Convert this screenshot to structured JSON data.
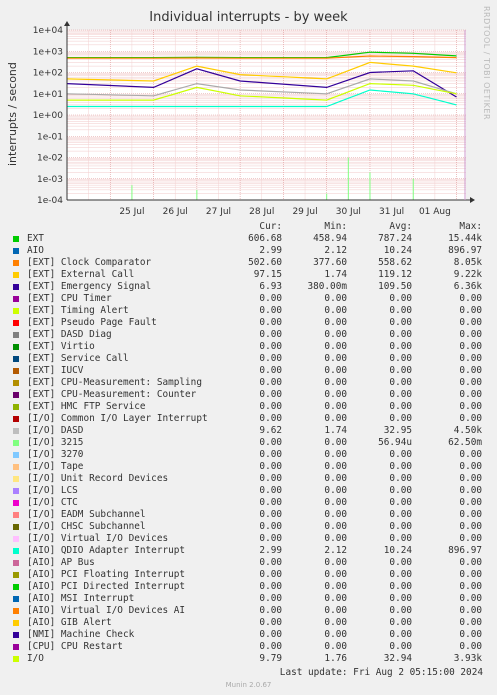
{
  "chart_data": {
    "type": "line",
    "title": "Individual interrupts - by week",
    "ylabel": "interrupts / second",
    "yscale": "log",
    "ylim": [
      0.0001,
      10000
    ],
    "yticks": [
      "1e-04",
      "1e-03",
      "1e-02",
      "1e-01",
      "1e+00",
      "1e+01",
      "1e+02",
      "1e+03",
      "1e+04"
    ],
    "xticks": [
      "25 Jul",
      "26 Jul",
      "27 Jul",
      "28 Jul",
      "29 Jul",
      "30 Jul",
      "31 Jul",
      "01 Aug"
    ],
    "xlim": [
      "2024-07-24",
      "2024-08-02"
    ],
    "series": [
      {
        "name": "EXT",
        "color": "#00cc00",
        "values": {
          "2024-07-24": 500,
          "2024-07-26": 500,
          "2024-07-27": 520,
          "2024-07-28": 500,
          "2024-07-30": 500,
          "2024-07-31": 900,
          "2024-08-01": 800,
          "2024-08-02": 607
        }
      },
      {
        "name": "[EXT] Clock Comparator",
        "color": "#ff8000",
        "values": {
          "2024-07-24": 470,
          "2024-07-26": 470,
          "2024-07-27": 480,
          "2024-07-28": 470,
          "2024-07-30": 470,
          "2024-07-31": 600,
          "2024-08-01": 560,
          "2024-08-02": 503
        }
      },
      {
        "name": "[EXT] External Call",
        "color": "#ffcc00",
        "values": {
          "2024-07-24": 50,
          "2024-07-26": 40,
          "2024-07-27": 200,
          "2024-07-28": 80,
          "2024-07-30": 50,
          "2024-07-31": 300,
          "2024-08-01": 200,
          "2024-08-02": 97
        }
      },
      {
        "name": "[EXT] Emergency Signal",
        "color": "#330099",
        "values": {
          "2024-07-24": 30,
          "2024-07-26": 20,
          "2024-07-27": 150,
          "2024-07-28": 40,
          "2024-07-30": 20,
          "2024-07-31": 100,
          "2024-08-01": 120,
          "2024-08-02": 7
        }
      },
      {
        "name": "[I/O] DASD",
        "color": "#aaaaaa",
        "values": {
          "2024-07-24": 10,
          "2024-07-26": 8,
          "2024-07-27": 30,
          "2024-07-28": 15,
          "2024-07-30": 10,
          "2024-07-31": 50,
          "2024-08-01": 40,
          "2024-08-02": 10
        }
      },
      {
        "name": "[AIO] QDIO Adapter Interrupt",
        "color": "#00ffcc",
        "values": {
          "2024-07-24": 2.5,
          "2024-07-26": 2.5,
          "2024-07-27": 2.5,
          "2024-07-28": 2.5,
          "2024-07-30": 2.5,
          "2024-07-31": 15,
          "2024-08-01": 10,
          "2024-08-02": 3
        }
      },
      {
        "name": "I/O",
        "color": "#ccff00",
        "values": {
          "2024-07-24": 5,
          "2024-07-26": 5,
          "2024-07-27": 20,
          "2024-07-28": 8,
          "2024-07-30": 5,
          "2024-07-31": 30,
          "2024-08-01": 25,
          "2024-08-02": 10
        }
      },
      {
        "name": "[I/O] 3215",
        "color": "#80ff80",
        "values": {
          "2024-07-25": 0.0001,
          "2024-07-25T12:00": 0.0005,
          "2024-07-27": 0.0003,
          "2024-07-30": 0.0002,
          "2024-07-30T12:00": 0.01,
          "2024-07-31": 0.002,
          "2024-08-01": 0.001
        }
      }
    ],
    "grid": true
  },
  "legend": {
    "headers": [
      "Cur:",
      "Min:",
      "Avg:",
      "Max:"
    ],
    "rows": [
      {
        "name": "EXT",
        "color": "#00cc00",
        "cur": "606.68",
        "min": "458.94",
        "avg": "787.24",
        "max": "15.44k"
      },
      {
        "name": "AIO",
        "color": "#0066b3",
        "cur": "2.99",
        "min": "2.12",
        "avg": "10.24",
        "max": "896.97"
      },
      {
        "name": "[EXT] Clock Comparator",
        "color": "#ff8000",
        "cur": "502.60",
        "min": "377.60",
        "avg": "558.62",
        "max": "8.05k"
      },
      {
        "name": "[EXT] External Call",
        "color": "#ffcc00",
        "cur": "97.15",
        "min": "1.74",
        "avg": "119.12",
        "max": "9.22k"
      },
      {
        "name": "[EXT] Emergency Signal",
        "color": "#330099",
        "cur": "6.93",
        "min": "380.00m",
        "avg": "109.50",
        "max": "6.36k"
      },
      {
        "name": "[EXT] CPU Timer",
        "color": "#990099",
        "cur": "0.00",
        "min": "0.00",
        "avg": "0.00",
        "max": "0.00"
      },
      {
        "name": "[EXT] Timing Alert",
        "color": "#ccff00",
        "cur": "0.00",
        "min": "0.00",
        "avg": "0.00",
        "max": "0.00"
      },
      {
        "name": "[EXT] Pseudo Page Fault",
        "color": "#ff0000",
        "cur": "0.00",
        "min": "0.00",
        "avg": "0.00",
        "max": "0.00"
      },
      {
        "name": "[EXT] DASD Diag",
        "color": "#808080",
        "cur": "0.00",
        "min": "0.00",
        "avg": "0.00",
        "max": "0.00"
      },
      {
        "name": "[EXT] Virtio",
        "color": "#008f00",
        "cur": "0.00",
        "min": "0.00",
        "avg": "0.00",
        "max": "0.00"
      },
      {
        "name": "[EXT] Service Call",
        "color": "#00487d",
        "cur": "0.00",
        "min": "0.00",
        "avg": "0.00",
        "max": "0.00"
      },
      {
        "name": "[EXT] IUCV",
        "color": "#b35a00",
        "cur": "0.00",
        "min": "0.00",
        "avg": "0.00",
        "max": "0.00"
      },
      {
        "name": "[EXT] CPU-Measurement: Sampling",
        "color": "#b38f00",
        "cur": "0.00",
        "min": "0.00",
        "avg": "0.00",
        "max": "0.00"
      },
      {
        "name": "[EXT] CPU-Measurement: Counter",
        "color": "#6b006b",
        "cur": "0.00",
        "min": "0.00",
        "avg": "0.00",
        "max": "0.00"
      },
      {
        "name": "[EXT] HMC FTP Service",
        "color": "#8fb300",
        "cur": "0.00",
        "min": "0.00",
        "avg": "0.00",
        "max": "0.00"
      },
      {
        "name": "[I/O] Common I/O Layer Interrupt",
        "color": "#b30000",
        "cur": "0.00",
        "min": "0.00",
        "avg": "0.00",
        "max": "0.00"
      },
      {
        "name": "[I/O] DASD",
        "color": "#bebebe",
        "cur": "9.62",
        "min": "1.74",
        "avg": "32.95",
        "max": "4.50k"
      },
      {
        "name": "[I/O] 3215",
        "color": "#80ff80",
        "cur": "0.00",
        "min": "0.00",
        "avg": "56.94u",
        "max": "62.50m"
      },
      {
        "name": "[I/O] 3270",
        "color": "#80c9ff",
        "cur": "0.00",
        "min": "0.00",
        "avg": "0.00",
        "max": "0.00"
      },
      {
        "name": "[I/O] Tape",
        "color": "#ffc080",
        "cur": "0.00",
        "min": "0.00",
        "avg": "0.00",
        "max": "0.00"
      },
      {
        "name": "[I/O] Unit Record Devices",
        "color": "#ffe680",
        "cur": "0.00",
        "min": "0.00",
        "avg": "0.00",
        "max": "0.00"
      },
      {
        "name": "[I/O] LCS",
        "color": "#aa80ff",
        "cur": "0.00",
        "min": "0.00",
        "avg": "0.00",
        "max": "0.00"
      },
      {
        "name": "[I/O] CTC",
        "color": "#ee00cc",
        "cur": "0.00",
        "min": "0.00",
        "avg": "0.00",
        "max": "0.00"
      },
      {
        "name": "[I/O] EADM Subchannel",
        "color": "#ff8080",
        "cur": "0.00",
        "min": "0.00",
        "avg": "0.00",
        "max": "0.00"
      },
      {
        "name": "[I/O] CHSC Subchannel",
        "color": "#666600",
        "cur": "0.00",
        "min": "0.00",
        "avg": "0.00",
        "max": "0.00"
      },
      {
        "name": "[I/O] Virtual I/O Devices",
        "color": "#ffbfff",
        "cur": "0.00",
        "min": "0.00",
        "avg": "0.00",
        "max": "0.00"
      },
      {
        "name": "[AIO] QDIO Adapter Interrupt",
        "color": "#00ffcc",
        "cur": "2.99",
        "min": "2.12",
        "avg": "10.24",
        "max": "896.97"
      },
      {
        "name": "[AIO] AP Bus",
        "color": "#cc6699",
        "cur": "0.00",
        "min": "0.00",
        "avg": "0.00",
        "max": "0.00"
      },
      {
        "name": "[AIO] PCI Floating Interrupt",
        "color": "#999900",
        "cur": "0.00",
        "min": "0.00",
        "avg": "0.00",
        "max": "0.00"
      },
      {
        "name": "[AIO] PCI Directed Interrupt",
        "color": "#00cc00",
        "cur": "0.00",
        "min": "0.00",
        "avg": "0.00",
        "max": "0.00"
      },
      {
        "name": "[AIO] MSI Interrupt",
        "color": "#0066b3",
        "cur": "0.00",
        "min": "0.00",
        "avg": "0.00",
        "max": "0.00"
      },
      {
        "name": "[AIO] Virtual I/O Devices AI",
        "color": "#ff8000",
        "cur": "0.00",
        "min": "0.00",
        "avg": "0.00",
        "max": "0.00"
      },
      {
        "name": "[AIO] GIB Alert",
        "color": "#ffcc00",
        "cur": "0.00",
        "min": "0.00",
        "avg": "0.00",
        "max": "0.00"
      },
      {
        "name": "[NMI] Machine Check",
        "color": "#330099",
        "cur": "0.00",
        "min": "0.00",
        "avg": "0.00",
        "max": "0.00"
      },
      {
        "name": "[CPU] CPU Restart",
        "color": "#990099",
        "cur": "0.00",
        "min": "0.00",
        "avg": "0.00",
        "max": "0.00"
      },
      {
        "name": "I/O",
        "color": "#ccff00",
        "cur": "9.79",
        "min": "1.76",
        "avg": "32.94",
        "max": "3.93k"
      }
    ]
  },
  "last_update": "Last update: Fri Aug  2 05:15:00 2024",
  "side_label": "RRDTOOL / TOBI OETIKER",
  "footer": "Munin 2.0.67"
}
